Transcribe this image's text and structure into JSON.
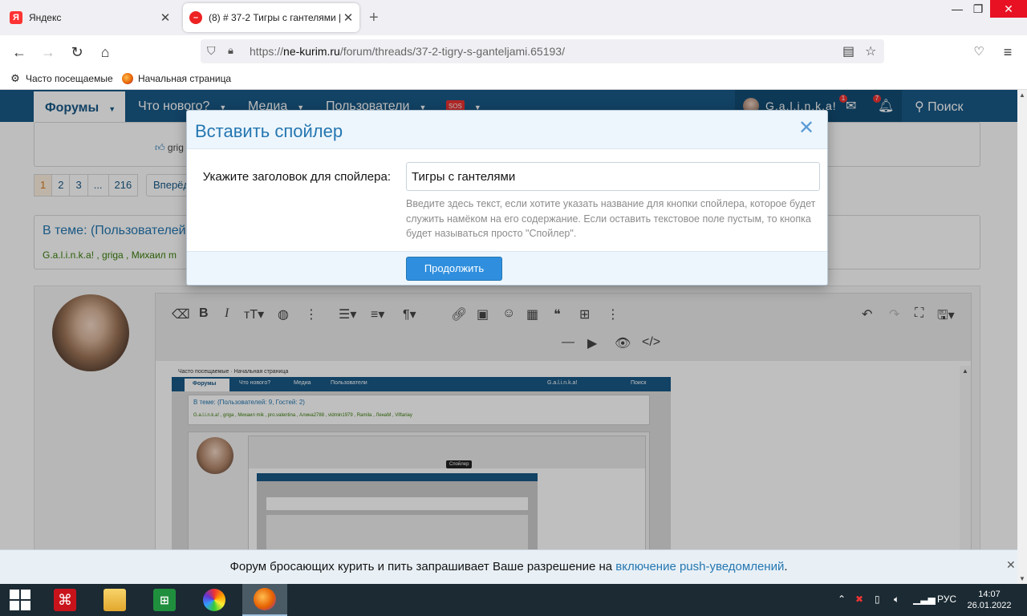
{
  "browser": {
    "tabs": [
      {
        "label": "Яндекс",
        "favicon": "Я"
      },
      {
        "label": "(8) # 37-2 Тигры с гантелями |",
        "favicon": ""
      }
    ],
    "url": {
      "scheme": "https://",
      "host": "ne-kurim.ru",
      "path": "/forum/threads/37-2-tigry-s-ganteljami.65193/"
    },
    "bookmarks": [
      "Часто посещаемые",
      "Начальная страница"
    ]
  },
  "forum": {
    "nav": {
      "home": "Форумы",
      "items": [
        "Что нового?",
        "Медиа",
        "Пользователи"
      ],
      "sos": "SOS",
      "user": "G.a.l.i.n.k.a!",
      "inbox_badge": "1",
      "alerts_badge": "7",
      "search": "Поиск"
    },
    "post_reaction_user": "grig",
    "pagination": [
      "1",
      "2",
      "3",
      "...",
      "216"
    ],
    "next_label": "Вперёд",
    "in_topic_title": "В теме: (Пользователей",
    "in_topic_members": "G.a.l.i.n.k.a! , griga , Михаил m"
  },
  "nested_screenshot": {
    "bookmarks": [
      "Часто посещаемые",
      "Начальная страница"
    ],
    "nav": [
      "Форумы",
      "Что нового?",
      "Медиа",
      "Пользователи",
      "G.a.l.i.n.k.a!",
      "Поиск"
    ],
    "topic_title": "В теме: (Пользователей: 9, Гостей: 2)",
    "topic_members": "G.a.l.i.n.k.a! , griga , Михаил mik , pro.valentina , Алина2788 , vidmin1979 , Ramila , ЛенаМ , Viftariay",
    "tooltip": "Спойлер"
  },
  "modal": {
    "title": "Вставить спойлер",
    "label": "Укажите заголовок для спойлера:",
    "input_value": "Тигры с гантелями",
    "hint": "Введите здесь текст, если хотите указать название для кнопки спойлера, которое будет служить намёком на его содержание. Если оставить текстовое поле пустым, то кнопка будет называться просто \"Спойлер\".",
    "button": "Продолжить"
  },
  "push": {
    "text": "Форум бросающих курить и пить запрашивает Ваше разрешение на",
    "link": "включение push-уведомлений",
    "end": "."
  },
  "taskbar": {
    "lang": "РУС",
    "time": "14:07",
    "date": "26.01.2022"
  }
}
